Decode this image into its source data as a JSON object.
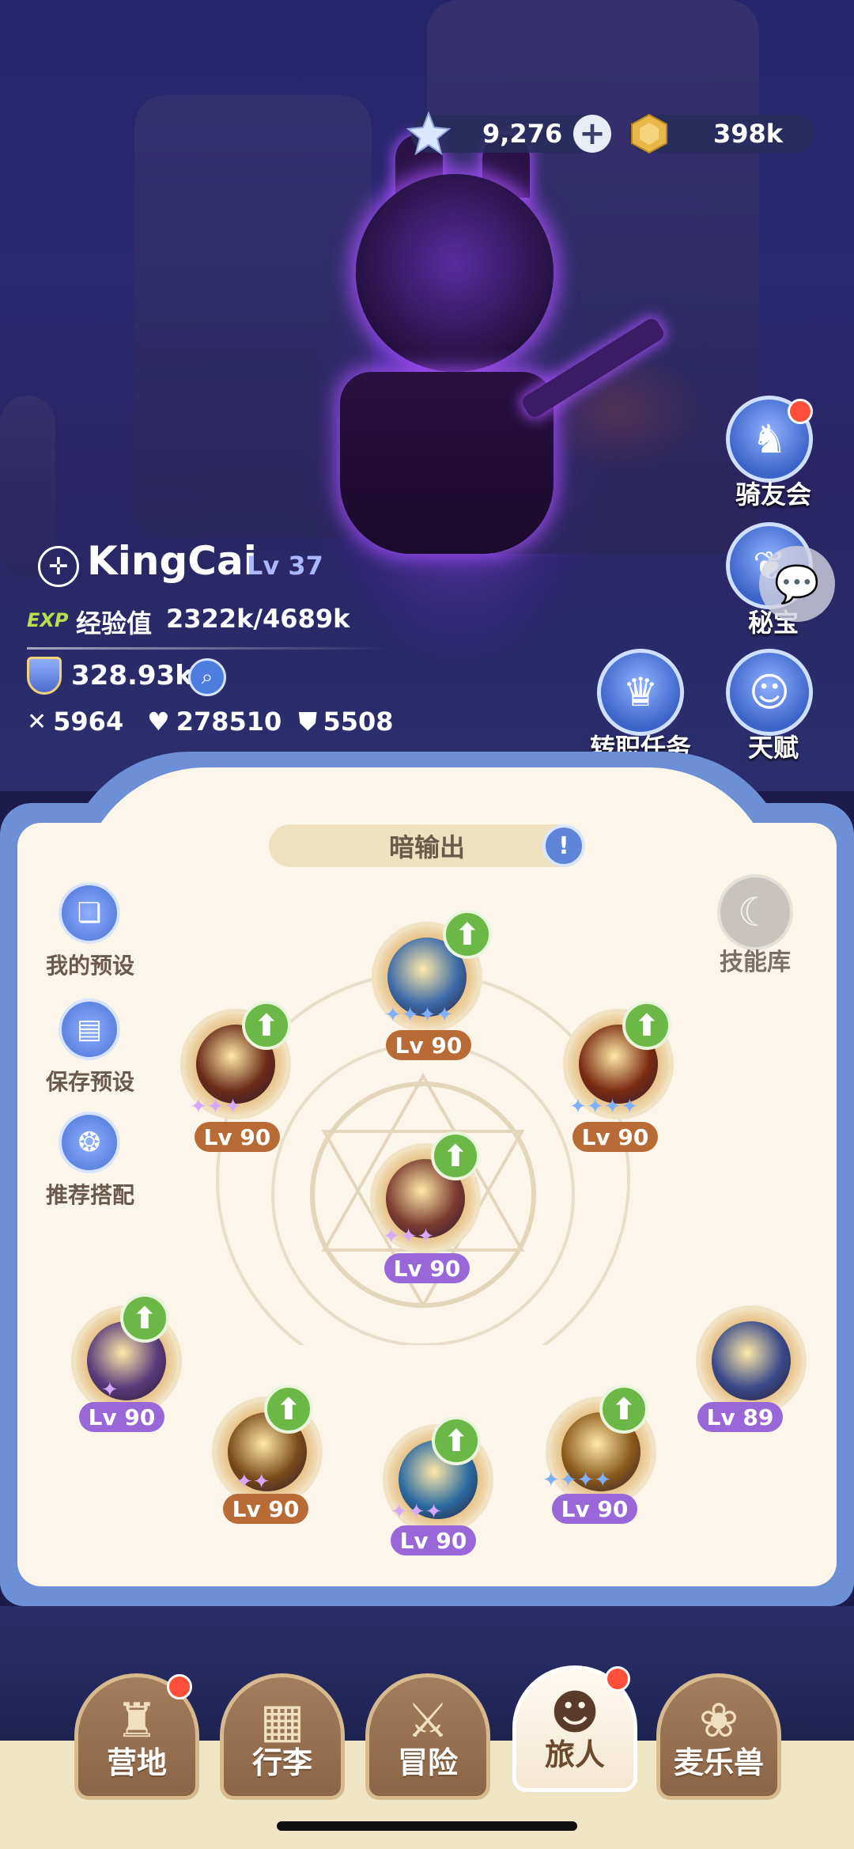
{
  "currency": {
    "star_value": "9,276",
    "gold_value": "398k"
  },
  "player": {
    "name": "KingCai",
    "level": "Lv 37",
    "exp_tag": "EXP",
    "exp_label": "经验值",
    "exp_value": "2322k/4689k",
    "power": "328.93k",
    "attack": "5964",
    "hp": "278510",
    "defense": "5508"
  },
  "side_buttons": [
    {
      "label": "骑友会",
      "icon": "horse-icon"
    },
    {
      "label": "秘宝",
      "icon": "treasure-icon"
    },
    {
      "label": "转职任务",
      "icon": "crown-icon"
    },
    {
      "label": "天赋",
      "icon": "mind-icon"
    }
  ],
  "panel": {
    "title": "暗输出",
    "skill_library_label": "技能库",
    "left_buttons": [
      {
        "label": "我的预设",
        "icon": "cards-icon"
      },
      {
        "label": "保存预设",
        "icon": "save-icon"
      },
      {
        "label": "推荐搭配",
        "icon": "recommend-icon"
      }
    ]
  },
  "skills": [
    {
      "level": "Lv 90",
      "stars": "✦✦✦✦",
      "star_color": "#7fb0ff",
      "badge": "brown",
      "upgrade": true
    },
    {
      "level": "Lv 90",
      "stars": "✦✦✦",
      "star_color": "#d6a8ff",
      "badge": "brown",
      "upgrade": true
    },
    {
      "level": "Lv 90",
      "stars": "✦✦✦✦",
      "star_color": "#7fb0ff",
      "badge": "brown",
      "upgrade": true
    },
    {
      "level": "Lv 90",
      "stars": "✦✦✦",
      "star_color": "#d6a8ff",
      "badge": "purple",
      "upgrade": true
    },
    {
      "level": "Lv 90",
      "stars": "✦",
      "star_color": "#d6a8ff",
      "badge": "purple",
      "upgrade": true
    },
    {
      "level": "Lv 90",
      "stars": "✦✦",
      "star_color": "#d6a8ff",
      "badge": "brown",
      "upgrade": true
    },
    {
      "level": "Lv 90",
      "stars": "✦✦✦",
      "star_color": "#d6a8ff",
      "badge": "purple",
      "upgrade": true
    },
    {
      "level": "Lv 90",
      "stars": "✦✦✦✦",
      "star_color": "#7fb0ff",
      "badge": "purple",
      "upgrade": true
    },
    {
      "level": "Lv 89",
      "stars": "",
      "star_color": "#7fb0ff",
      "badge": "purple",
      "upgrade": false
    }
  ],
  "nav": [
    {
      "label": "营地",
      "icon": "castle-icon",
      "active": false,
      "badge": true
    },
    {
      "label": "行李",
      "icon": "backpack-icon",
      "active": false,
      "badge": false
    },
    {
      "label": "冒险",
      "icon": "swords-icon",
      "active": false,
      "badge": false
    },
    {
      "label": "旅人",
      "icon": "character-icon",
      "active": true,
      "badge": true
    },
    {
      "label": "麦乐兽",
      "icon": "pet-icon",
      "active": false,
      "badge": false
    }
  ]
}
